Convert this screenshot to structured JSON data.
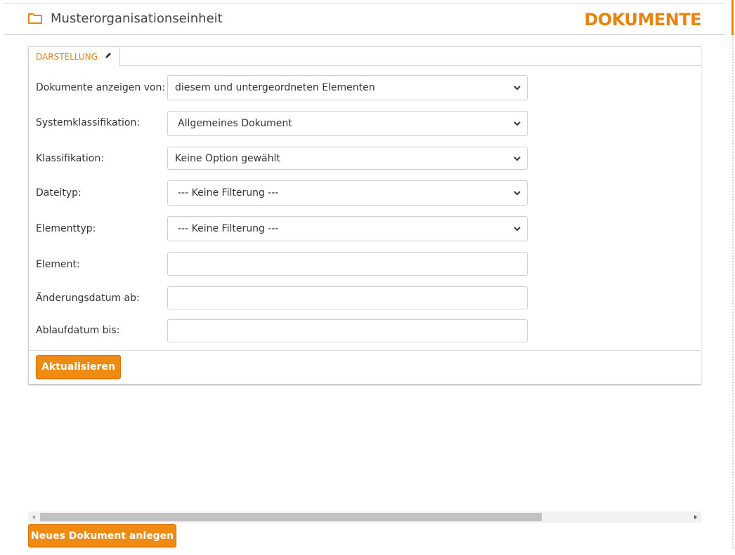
{
  "header": {
    "org_unit": "Musterorganisationseinheit",
    "page_title": "DOKUMENTE",
    "folder_icon": "folder-icon"
  },
  "colors": {
    "accent": "#e8840f",
    "button": "#ef8a12"
  },
  "tab": {
    "label": "DARSTELLUNG",
    "icon": "pencil-icon"
  },
  "form": {
    "fields": [
      {
        "label": "Dokumente anzeigen von:",
        "type": "select",
        "value": "diesem und untergeordneten Elementen"
      },
      {
        "label": "Systemklassifikation:",
        "type": "select",
        "value": "Allgemeines Dokument"
      },
      {
        "label": "Klassifikation:",
        "type": "select",
        "value": "Keine Option gewählt"
      },
      {
        "label": "Dateityp:",
        "type": "select",
        "value": "--- Keine Filterung ---"
      },
      {
        "label": "Elementtyp:",
        "type": "select",
        "value": "--- Keine Filterung ---"
      },
      {
        "label": "Element:",
        "type": "input",
        "value": ""
      },
      {
        "label": "Änderungsdatum ab:",
        "type": "input",
        "value": ""
      },
      {
        "label": "Ablaufdatum bis:",
        "type": "input",
        "value": ""
      }
    ],
    "submit_label": "Aktualisieren"
  },
  "actions": {
    "new_document_label": "Neues Dokument anlegen"
  }
}
